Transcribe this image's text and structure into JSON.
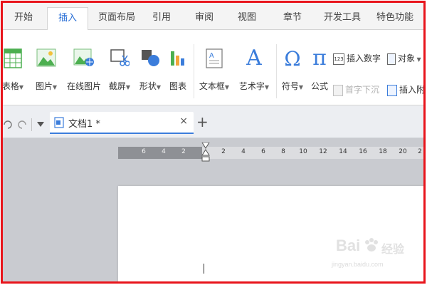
{
  "ribbon_tabs": [
    {
      "label": "开始"
    },
    {
      "label": "插入",
      "active": true
    },
    {
      "label": "页面布局"
    },
    {
      "label": "引用"
    },
    {
      "label": "审阅"
    },
    {
      "label": "视图"
    },
    {
      "label": "章节"
    },
    {
      "label": "开发工具"
    },
    {
      "label": "特色功能"
    }
  ],
  "ribbon_tools": {
    "table": "表格",
    "picture": "图片",
    "online_picture": "在线图片",
    "screenshot": "截屏",
    "shapes": "形状",
    "chart": "图表",
    "textbox": "文本框",
    "wordart": "艺术字",
    "symbol": "符号",
    "formula": "公式",
    "formula_glyph": "π",
    "omega_glyph": "Ω",
    "wordart_glyph": "A"
  },
  "ribbon_small": {
    "insert_number": "插入数字",
    "insert_number_icon_text": "123",
    "object": "对象",
    "drop_cap": "首字下沉",
    "insert_attachment": "插入附"
  },
  "document": {
    "tab_title": "文档1 *",
    "close_glyph": "×",
    "new_tab_glyph": "+"
  },
  "ruler": {
    "left_ticks": [
      "6",
      "4",
      "2"
    ],
    "right_ticks": [
      "2",
      "4",
      "6",
      "8",
      "10",
      "12",
      "14",
      "16",
      "18",
      "20",
      "2"
    ]
  },
  "watermark": {
    "brand": "Bai",
    "brand_cn": "经验",
    "url": "jingyan.baidu.com"
  },
  "colors": {
    "frame": "#e8141b",
    "accent": "#2a6fd6",
    "icon_green": "#4caf50",
    "icon_blue": "#3b7ddb"
  }
}
